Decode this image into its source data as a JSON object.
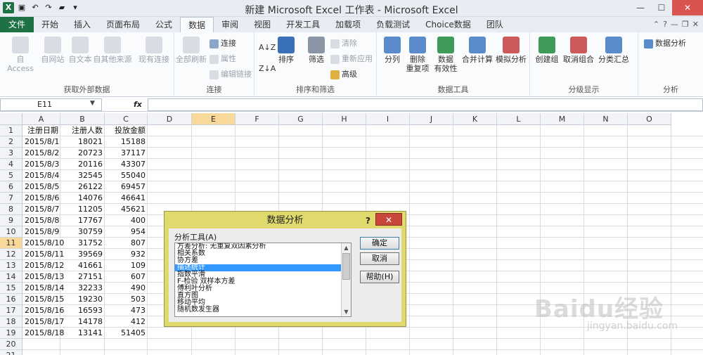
{
  "window": {
    "title": "新建 Microsoft Excel 工作表 - Microsoft Excel"
  },
  "tabs": [
    "文件",
    "开始",
    "插入",
    "页面布局",
    "公式",
    "数据",
    "审阅",
    "视图",
    "开发工具",
    "加载项",
    "负载测试",
    "Choice数据",
    "团队"
  ],
  "active_tab": "数据",
  "ribbon": {
    "groups": [
      {
        "label": "获取外部数据",
        "buttons": [
          "自 Access",
          "自网站",
          "自文本",
          "自其他来源",
          "现有连接"
        ]
      },
      {
        "label": "连接",
        "buttons": [
          "全部刷新",
          "连接",
          "属性",
          "编辑链接"
        ]
      },
      {
        "label": "排序和筛选",
        "buttons": [
          "排序",
          "筛选",
          "清除",
          "重新应用",
          "高级"
        ]
      },
      {
        "label": "数据工具",
        "buttons": [
          "分列",
          "删除",
          "重复项",
          "数据",
          "有效性",
          "合并计算",
          "模拟分析"
        ]
      },
      {
        "label": "分级显示",
        "buttons": [
          "创建组",
          "取消组合",
          "分类汇总"
        ]
      },
      {
        "label": "分析",
        "buttons": [
          "数据分析"
        ]
      }
    ]
  },
  "formula_bar": {
    "name_box": "E11",
    "fx": "fx",
    "formula": ""
  },
  "columns": [
    "A",
    "B",
    "C",
    "D",
    "E",
    "F",
    "G",
    "H",
    "I",
    "J",
    "K",
    "L",
    "M",
    "N",
    "O"
  ],
  "selected_col": "E",
  "selected_row": "11",
  "rows": [
    "1",
    "2",
    "3",
    "4",
    "5",
    "6",
    "7",
    "8",
    "9",
    "10",
    "11",
    "12",
    "13",
    "14",
    "15",
    "16",
    "17",
    "18",
    "19",
    "20",
    "21"
  ],
  "sheet": {
    "headers": [
      "注册日期",
      "注册人数",
      "投放金额"
    ],
    "data": [
      [
        "2015/8/1",
        "18021",
        "15188"
      ],
      [
        "2015/8/2",
        "20723",
        "37117"
      ],
      [
        "2015/8/3",
        "20116",
        "43307"
      ],
      [
        "2015/8/4",
        "32545",
        "55040"
      ],
      [
        "2015/8/5",
        "26122",
        "69457"
      ],
      [
        "2015/8/6",
        "14076",
        "46641"
      ],
      [
        "2015/8/7",
        "11205",
        "45621"
      ],
      [
        "2015/8/8",
        "17767",
        "400"
      ],
      [
        "2015/8/9",
        "30759",
        "954"
      ],
      [
        "2015/8/10",
        "31752",
        "807"
      ],
      [
        "2015/8/11",
        "39569",
        "932"
      ],
      [
        "2015/8/12",
        "41661",
        "109"
      ],
      [
        "2015/8/13",
        "27151",
        "607"
      ],
      [
        "2015/8/14",
        "32233",
        "490"
      ],
      [
        "2015/8/15",
        "19230",
        "503"
      ],
      [
        "2015/8/16",
        "16593",
        "473"
      ],
      [
        "2015/8/17",
        "14178",
        "412"
      ],
      [
        "2015/8/18",
        "13141",
        "51405"
      ]
    ]
  },
  "dialog": {
    "title": "数据分析",
    "help": "?",
    "close": "✕",
    "list_label": "分析工具(A)",
    "items": [
      "方差分析: 无重复双因素分析",
      "相关系数",
      "协方差",
      "描述统计",
      "指数平滑",
      "F-检验 双样本方差",
      "傅利叶分析",
      "直方图",
      "移动平均",
      "随机数发生器"
    ],
    "selected_index": 3,
    "ok": "确定",
    "cancel": "取消",
    "help_btn": "帮助(H)"
  },
  "watermark": {
    "main": "Baidu经验",
    "sub": "jingyan.baidu.com"
  },
  "colors": {
    "excel_green": "#1e7145",
    "selection": "#f9d99a",
    "dialog_frame": "#e0da6d",
    "list_select": "#3399ff"
  }
}
